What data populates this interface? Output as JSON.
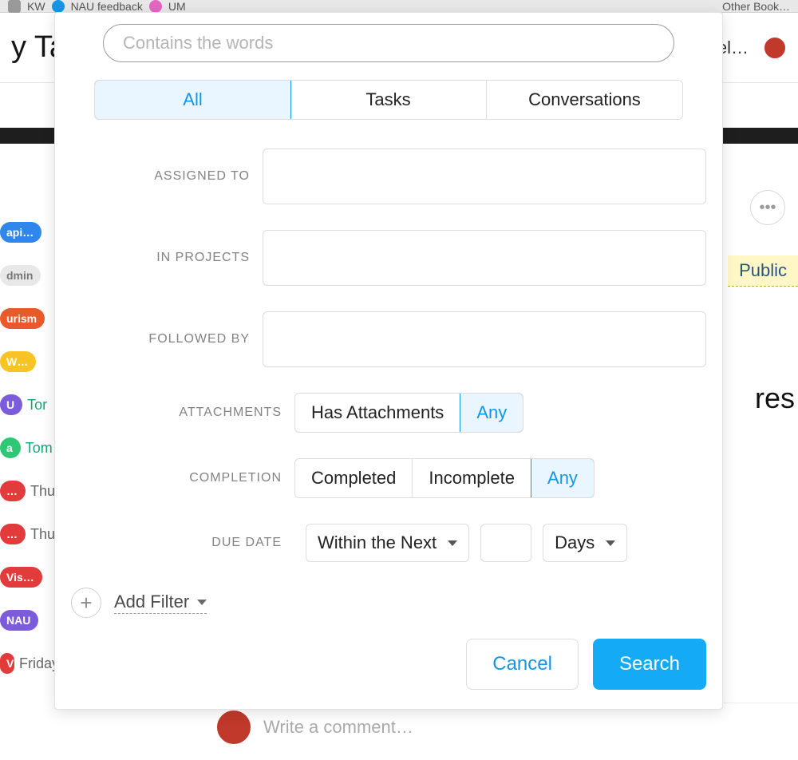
{
  "background": {
    "bookmarks": [
      "KW",
      "NAU feedback",
      "UM"
    ],
    "other_books": "Other Book…",
    "page_title_fragment": "y Ta",
    "workspace": "Freel…",
    "public_badge": "Public",
    "right_word_fragment": "res",
    "sidebar": [
      {
        "tag": "api…",
        "color": "#2f86eb",
        "meta": ""
      },
      {
        "tag": "dmin",
        "color": "#e8e8e8",
        "meta": "",
        "text_color": "#777"
      },
      {
        "tag": "urism",
        "color": "#e85a2a",
        "meta": ""
      },
      {
        "tag": "W…",
        "color": "#f7c325",
        "meta": ""
      },
      {
        "tag": "U",
        "color": "#7d5cdb",
        "meta": "Tor",
        "meta_color": "#17a673"
      },
      {
        "tag": "a",
        "color": "#2fc776",
        "meta": "Tom",
        "meta_color": "#17a673"
      },
      {
        "tag": "…",
        "color": "#e23b3b",
        "meta": "Thu"
      },
      {
        "tag": "…",
        "color": "#e23b3b",
        "meta": "Thu"
      },
      {
        "tag": "Vis…",
        "color": "#e23b3b",
        "meta": ""
      },
      {
        "tag": "NAU",
        "color": "#7d5cdb",
        "meta": ""
      },
      {
        "tag": "Vis…",
        "color": "#e23b3b",
        "meta": "Friday"
      }
    ],
    "comment_placeholder": "Write a comment…"
  },
  "search": {
    "placeholder": "Contains the words",
    "tabs": {
      "all": "All",
      "tasks": "Tasks",
      "conversations": "Conversations",
      "active": "all"
    },
    "filters": {
      "assigned_to": {
        "label": "ASSIGNED TO"
      },
      "in_projects": {
        "label": "IN PROJECTS"
      },
      "followed_by": {
        "label": "FOLLOWED BY"
      },
      "attachments": {
        "label": "ATTACHMENTS",
        "options": [
          "Has Attachments",
          "Any"
        ],
        "active": "Any"
      },
      "completion": {
        "label": "COMPLETION",
        "options": [
          "Completed",
          "Incomplete",
          "Any"
        ],
        "active": "Any"
      },
      "due_date": {
        "label": "DUE DATE",
        "range": "Within the Next",
        "unit": "Days"
      }
    },
    "add_filter": "Add Filter",
    "buttons": {
      "cancel": "Cancel",
      "search": "Search"
    }
  }
}
